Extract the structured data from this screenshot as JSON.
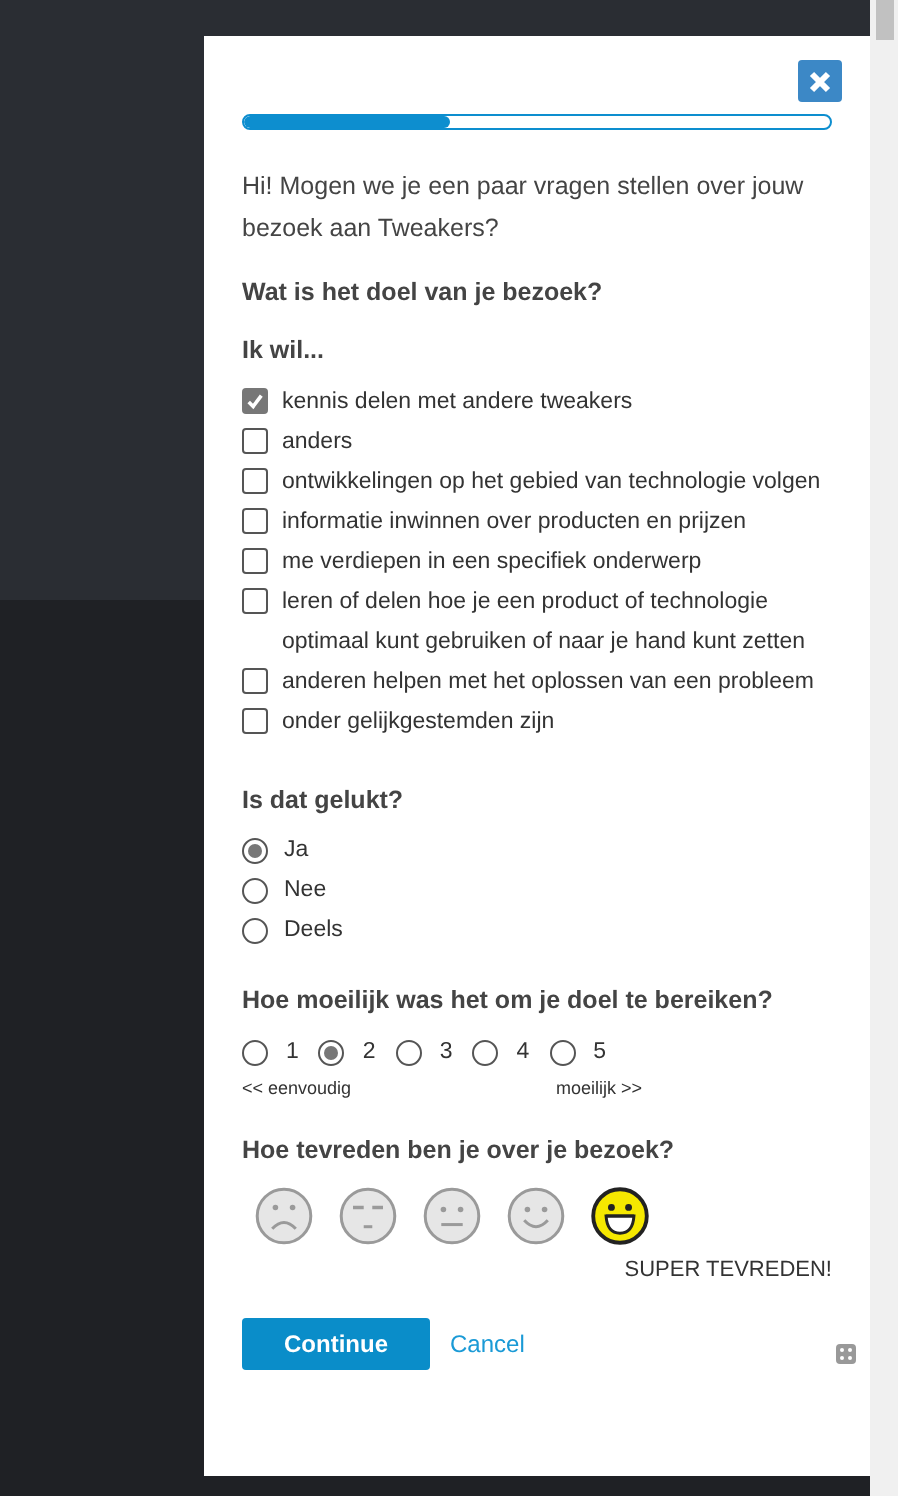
{
  "progress": {
    "level": 0.35
  },
  "intro": "Hi! Mogen we je een paar vragen stellen over jouw bezoek aan Tweakers?",
  "goal": {
    "question": "Wat is het doel van je bezoek?",
    "subheading": "Ik wil...",
    "options": [
      {
        "label": "kennis delen met andere tweakers",
        "checked": true
      },
      {
        "label": "anders",
        "checked": false
      },
      {
        "label": "ontwikkelingen op het gebied van technologie volgen",
        "checked": false
      },
      {
        "label": "informatie inwinnen over producten en prijzen",
        "checked": false
      },
      {
        "label": "me verdiepen in een specifiek onderwerp",
        "checked": false
      },
      {
        "label": "leren of delen hoe je een product of technologie optimaal kunt gebruiken of naar je hand kunt zetten",
        "checked": false
      },
      {
        "label": "anderen helpen met het oplossen van een probleem",
        "checked": false
      },
      {
        "label": "onder gelijkgestemden zijn",
        "checked": false
      }
    ]
  },
  "success": {
    "question": "Is dat gelukt?",
    "options": [
      {
        "label": "Ja",
        "selected": true
      },
      {
        "label": "Nee",
        "selected": false
      },
      {
        "label": "Deels",
        "selected": false
      }
    ]
  },
  "difficulty": {
    "question": "Hoe moeilijk was het om je doel te bereiken?",
    "options": [
      {
        "label": "1",
        "selected": false
      },
      {
        "label": "2",
        "selected": true
      },
      {
        "label": "3",
        "selected": false
      },
      {
        "label": "4",
        "selected": false
      },
      {
        "label": "5",
        "selected": false
      }
    ],
    "low_label": "<< eenvoudig",
    "high_label": "moeilijk >>"
  },
  "satisfaction": {
    "question": "Hoe tevreden ben je over je bezoek?",
    "faces": [
      {
        "kind": "sad",
        "selected": false
      },
      {
        "kind": "annoyed",
        "selected": false
      },
      {
        "kind": "neutral",
        "selected": false
      },
      {
        "kind": "smile",
        "selected": false
      },
      {
        "kind": "grin",
        "selected": true
      }
    ],
    "caption": "SUPER TEVREDEN!"
  },
  "buttons": {
    "continue": "Continue",
    "cancel": "Cancel"
  }
}
